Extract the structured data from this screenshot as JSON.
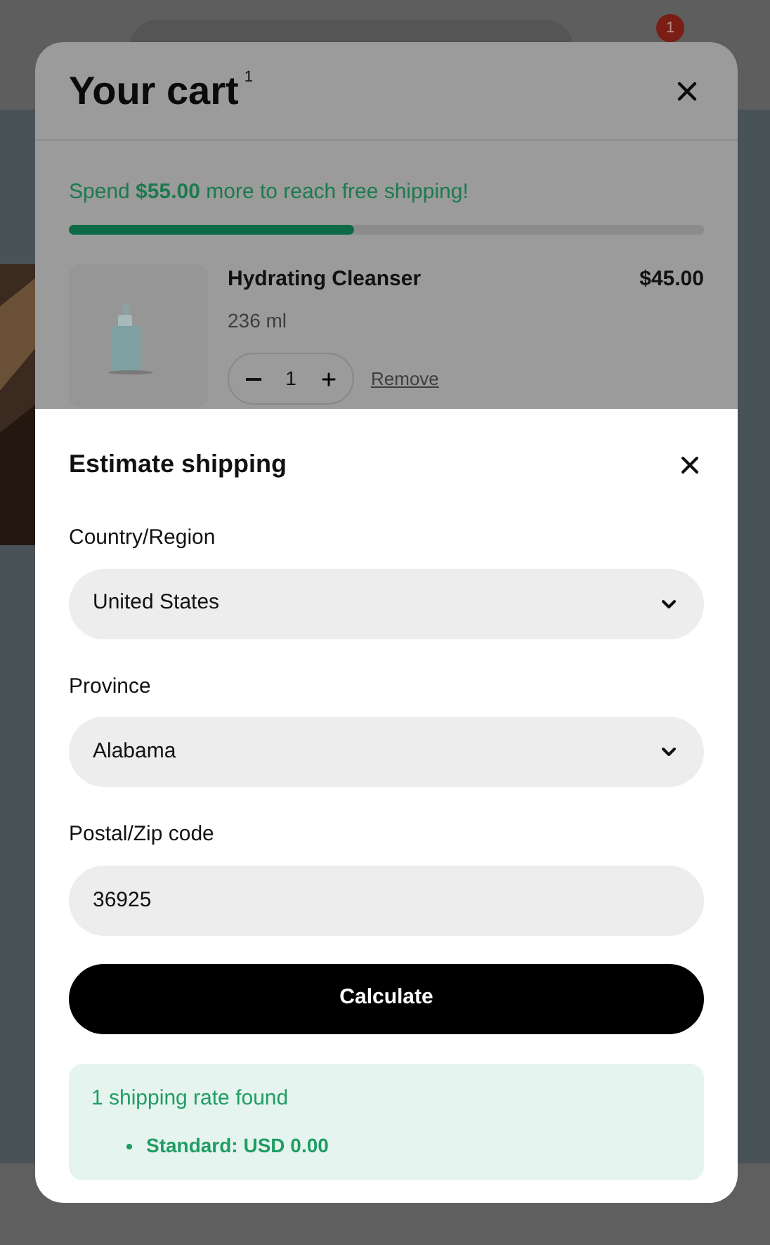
{
  "header": {
    "cart_count": "1"
  },
  "cart": {
    "title": "Your cart",
    "count": "1",
    "free_shipping": {
      "message": "Spend **$55.00** more to reach free shipping!",
      "level": 0.45
    },
    "items": [
      {
        "name": "Hydrating Cleanser",
        "variant": "236 ml",
        "price": "$45.00",
        "quantity": "1",
        "remove": "Remove"
      }
    ]
  },
  "shipping": {
    "title": "Estimate shipping",
    "fields": [
      {
        "kind": "select",
        "label": "Country/Region",
        "value": "United States"
      },
      {
        "kind": "select",
        "label": "Province",
        "value": "Alabama"
      },
      {
        "kind": "text",
        "label": "Postal/Zip code",
        "value": "36925"
      }
    ],
    "button": "Calculate",
    "result": {
      "title": "1 shipping rate found",
      "rates": [
        "Standard: USD 0.00"
      ]
    }
  }
}
